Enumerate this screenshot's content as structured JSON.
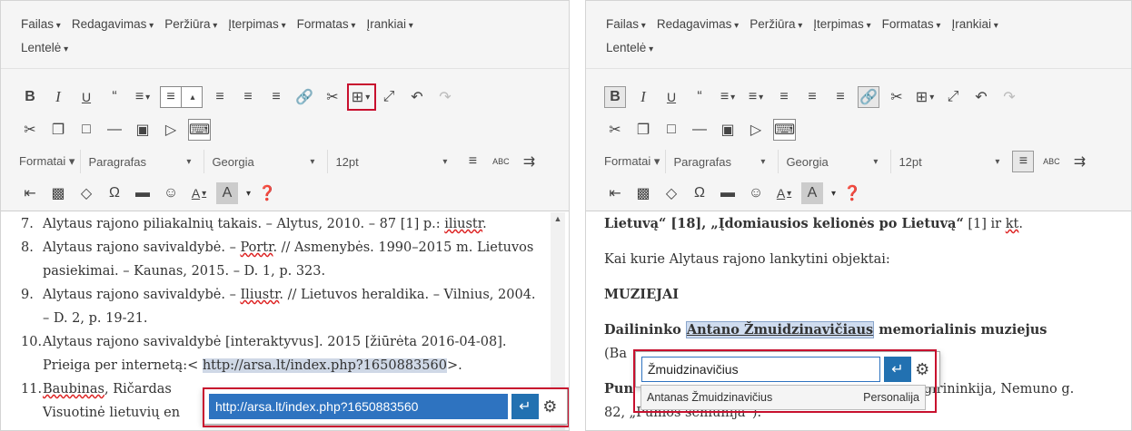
{
  "menu": [
    "Failas",
    "Redagavimas",
    "Peržiūra",
    "Įterpimas",
    "Formatas",
    "Įrankiai",
    "Lentelė"
  ],
  "toolbar": {
    "bold": "B",
    "italic": "I",
    "underline": "U",
    "formats_label": "Formatai",
    "block_format": "Paragrafas",
    "font_family": "Georgia",
    "font_size": "12pt"
  },
  "left": {
    "list_items": [
      {
        "num": "7.",
        "html": "Alytaus rajono piliakalnių takais. – Alytus, 2010. – 87 [1] p.: <span class='uw'>iliustr</span>."
      },
      {
        "num": "8.",
        "html": "Alytaus rajono savivaldybė. – <span class='uw'>Portr</span>. // Asmenybės. 1990–2015 m. Lietuvos pasiekimai. – Kaunas, 2015. – D. 1, p. 323."
      },
      {
        "num": "9.",
        "html": "Alytaus rajono savivaldybė. – <span class='uw'>Iliustr</span>. // Lietuvos heraldika. – Vilnius, 2004. – D. 2, p. 19-21."
      },
      {
        "num": "10.",
        "html": "Alytaus rajono savivaldybė [interaktyvus]. 2015 [žiūrėta 2016-04-08]. Prieiga per internetą:&lt; <span class='hl'>http://arsa.lt/index.php?1650883560</span>&gt;."
      },
      {
        "num": "11.",
        "html": "<span class='uw'>Baubinas</span>, Ričardas<br>Visuotinė lietuvių en"
      }
    ],
    "link_popup_value": "http://arsa.lt/index.php?1650883560"
  },
  "right": {
    "line1_pre": "Lietuvą“ [18], ",
    "line1_bold": "„Įdomiausios kelionės po Lietuvą“",
    "line1_post": " [1] ir ",
    "line1_kt": "kt",
    "line2": "Kai kurie Alytaus rajono lankytini objektai:",
    "heading": "MUZIEJAI",
    "museum_pre": "Dailininko ",
    "museum_hl": "Antano Žmuidzinavičiaus",
    "museum_post": " memorialinis muziejus",
    "paren_start": "(Ba",
    "punia_start": "Pun",
    "punia_end": "nios girininkija, Nemuno g.",
    "last_line": "82, „Punios seniūnija“).",
    "link_popup_value": "Žmuidzinavičius",
    "autocomplete": {
      "title": "Antanas Žmuidzinavičius",
      "type": "Personalija"
    }
  },
  "colors": {
    "accent": "#2271b1",
    "highlight_outline": "#c8102e"
  }
}
